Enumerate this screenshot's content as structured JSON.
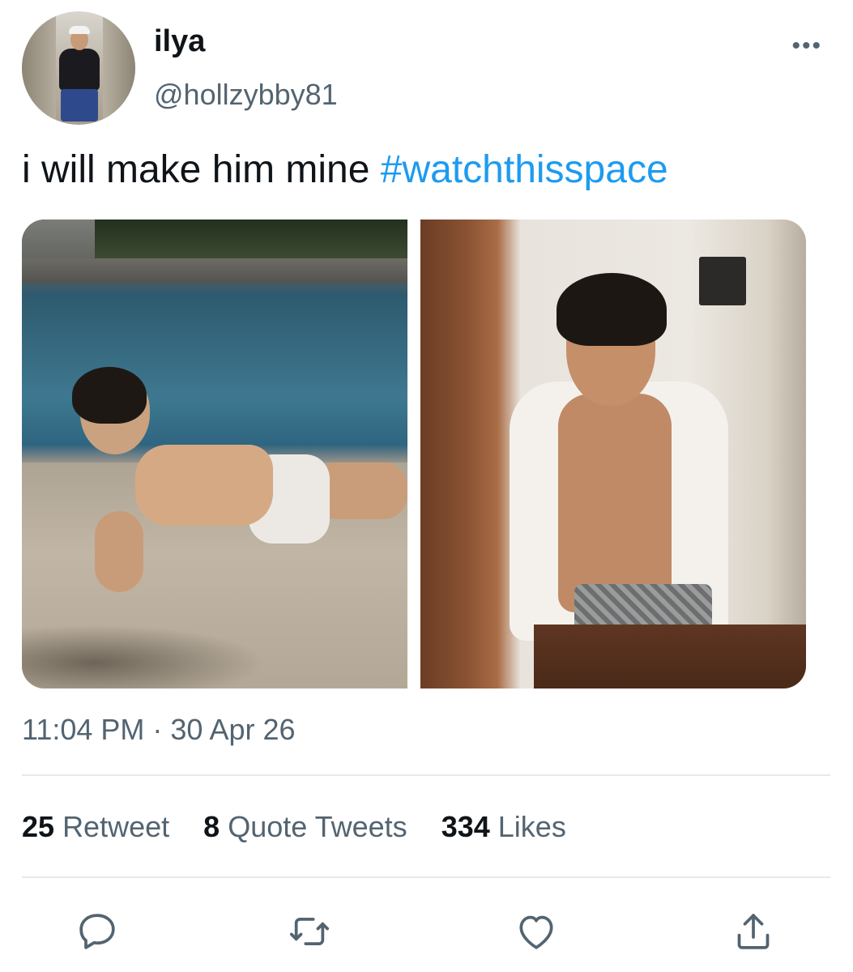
{
  "author": {
    "name": "ilya",
    "handle": "@hollzybby81"
  },
  "tweet": {
    "text": "i will make him mine ",
    "hashtag": "#watchthisspace",
    "timestamp": "11:04 PM · 30 Apr 26"
  },
  "stats": {
    "retweets": {
      "count": "25",
      "label": "Retweet"
    },
    "quotes": {
      "count": "8",
      "label": "Quote Tweets"
    },
    "likes": {
      "count": "334",
      "label": "Likes"
    }
  },
  "menu": {
    "more": "•••"
  },
  "colors": {
    "link": "#1d9bf0",
    "secondary_text": "#536471",
    "primary_text": "#0f1419",
    "divider": "#e6e9eb"
  },
  "icons": {
    "reply": "reply-icon",
    "retweet": "retweet-icon",
    "like": "like-icon",
    "share": "share-icon",
    "more": "more-icon"
  }
}
